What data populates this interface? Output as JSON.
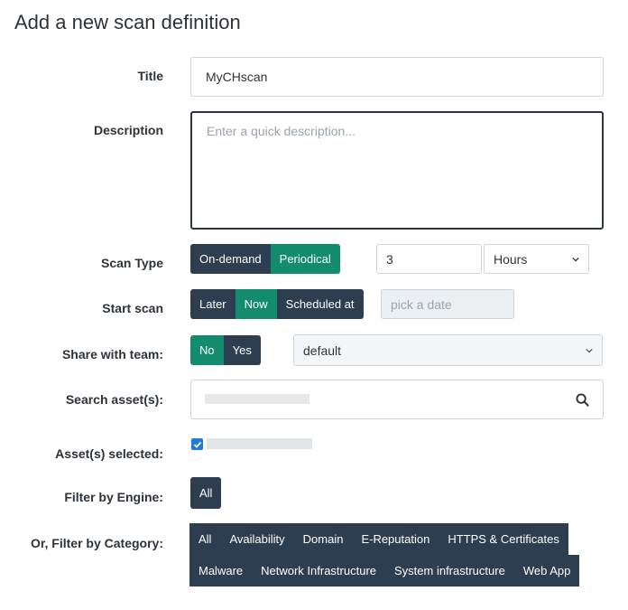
{
  "page_title": "Add a new scan definition",
  "labels": {
    "title": "Title",
    "description": "Description",
    "scan_type": "Scan Type",
    "start_scan": "Start scan",
    "share_with_team": "Share with team:",
    "search_assets": "Search asset(s):",
    "assets_selected": "Asset(s) selected:",
    "filter_engine": "Filter by Engine:",
    "filter_category": "Or, Filter by Category:"
  },
  "title_input": {
    "value": "MyCHscan"
  },
  "description_input": {
    "placeholder": "Enter a quick description..."
  },
  "scan_type": {
    "options": [
      "On-demand",
      "Periodical"
    ],
    "selected": "Periodical",
    "interval_value": "3",
    "interval_unit": "Hours"
  },
  "start_scan": {
    "options": [
      "Later",
      "Now",
      "Scheduled at"
    ],
    "selected": "Now",
    "date_placeholder": "pick a date"
  },
  "share_team": {
    "options": [
      "No",
      "Yes"
    ],
    "selected": "No",
    "team": "default"
  },
  "search": {
    "icon": "search-icon"
  },
  "assets_selected": {
    "checked": true
  },
  "filter_engine": {
    "options": [
      "All"
    ]
  },
  "filter_category": {
    "row1": [
      "All",
      "Availability",
      "Domain",
      "E-Reputation",
      "HTTPS & Certificates"
    ],
    "row2": [
      "Malware",
      "Network Infrastructure",
      "System infrastructure",
      "Web App"
    ]
  },
  "colors": {
    "dark_button": "#2c3e50",
    "active_button": "#138c6e",
    "checkbox": "#1f7ae0"
  }
}
